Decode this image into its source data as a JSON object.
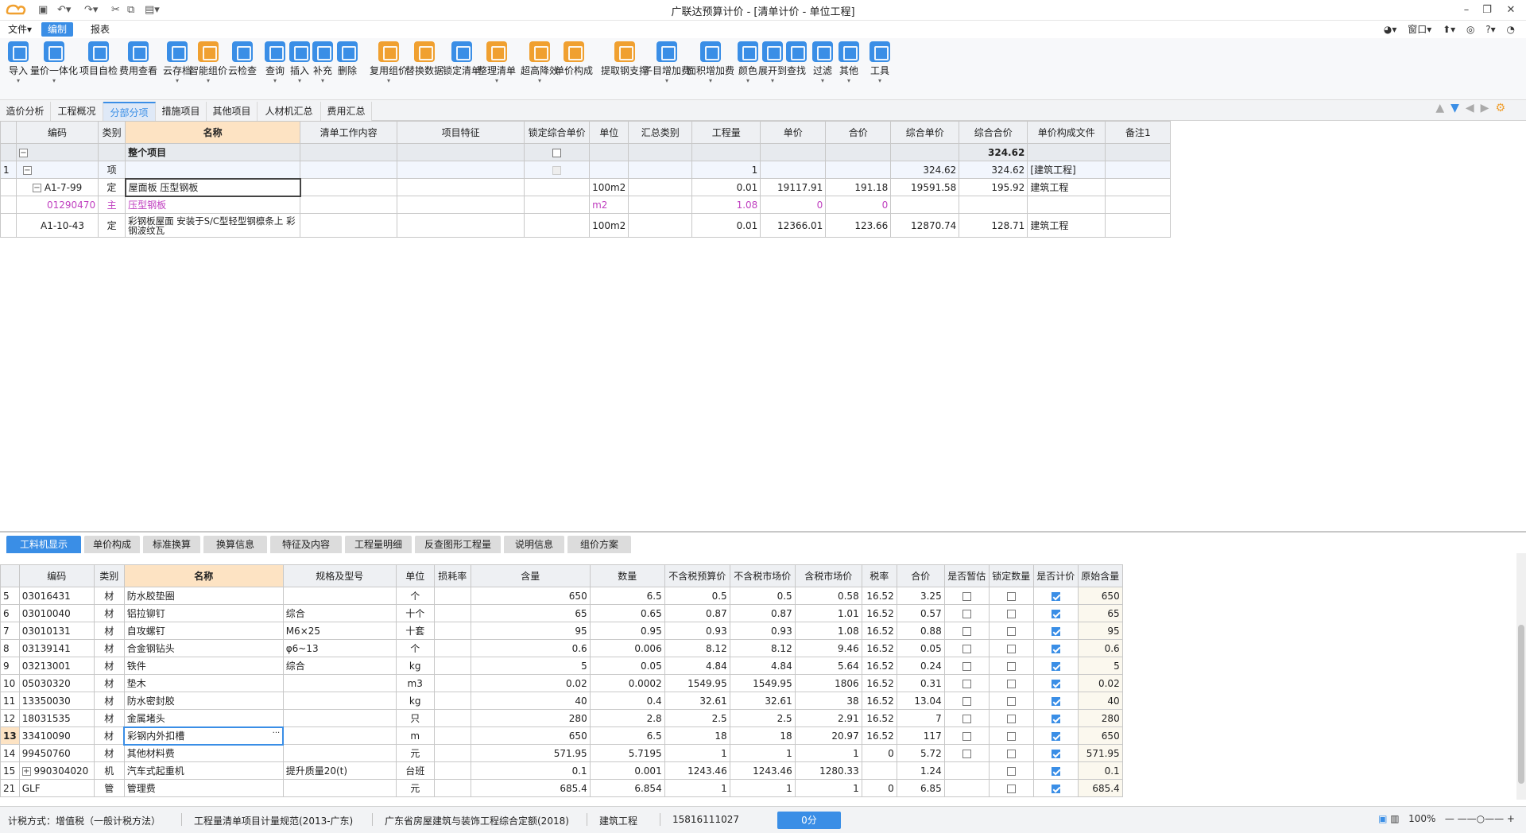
{
  "app": {
    "title": "广联达预算计价 - [清单计价 - 单位工程]"
  },
  "menu": {
    "file": "文件▾",
    "edit": "编制",
    "report": "报表"
  },
  "topright": {
    "window": "窗口▾",
    "help": "?▾"
  },
  "ribbon": [
    {
      "label": "导入",
      "icon": "import-icon",
      "color": "#3a8ee6",
      "dd": true
    },
    {
      "label": "量价一体化",
      "icon": "quantity-price-icon",
      "color": "#3a8ee6",
      "dd": true
    },
    {
      "label": "项目自检",
      "icon": "self-check-icon",
      "color": "#3a8ee6",
      "dd": false
    },
    {
      "label": "费用查看",
      "icon": "fee-view-icon",
      "color": "#3a8ee6",
      "dd": false
    },
    {
      "label": "云存档",
      "icon": "cloud-save-icon",
      "color": "#3a8ee6",
      "dd": true
    },
    {
      "label": "智能组价",
      "icon": "smart-price-icon",
      "color": "#f0a030",
      "dd": true
    },
    {
      "label": "云检查",
      "icon": "cloud-check-icon",
      "color": "#3a8ee6",
      "dd": false
    },
    {
      "label": "查询",
      "icon": "query-icon",
      "color": "#3a8ee6",
      "dd": true
    },
    {
      "label": "插入",
      "icon": "insert-icon",
      "color": "#3a8ee6",
      "dd": true
    },
    {
      "label": "补充",
      "icon": "supplement-icon",
      "color": "#3a8ee6",
      "dd": true
    },
    {
      "label": "删除",
      "icon": "delete-icon",
      "color": "#3a8ee6",
      "dd": false
    },
    {
      "label": "复用组价",
      "icon": "reuse-price-icon",
      "color": "#f0a030",
      "dd": true
    },
    {
      "label": "替换数据",
      "icon": "replace-data-icon",
      "color": "#f0a030",
      "dd": false
    },
    {
      "label": "锁定清单",
      "icon": "lock-list-icon",
      "color": "#3a8ee6",
      "dd": false
    },
    {
      "label": "整理清单",
      "icon": "organize-list-icon",
      "color": "#f0a030",
      "dd": true
    },
    {
      "label": "超高降效",
      "icon": "height-reduce-icon",
      "color": "#f0a030",
      "dd": true
    },
    {
      "label": "单价构成",
      "icon": "unit-price-icon",
      "color": "#f0a030",
      "dd": false
    },
    {
      "label": "提取钢支撑",
      "icon": "steel-support-icon",
      "color": "#f0a030",
      "dd": false
    },
    {
      "label": "子目增加费",
      "icon": "sub-item-fee-icon",
      "color": "#3a8ee6",
      "dd": true
    },
    {
      "label": "面积增加费",
      "icon": "area-fee-icon",
      "color": "#3a8ee6",
      "dd": true
    },
    {
      "label": "颜色",
      "icon": "color-icon",
      "color": "#3a8ee6",
      "dd": true
    },
    {
      "label": "展开到",
      "icon": "expand-icon",
      "color": "#3a8ee6",
      "dd": true
    },
    {
      "label": "查找",
      "icon": "find-icon",
      "color": "#3a8ee6",
      "dd": false
    },
    {
      "label": "过滤",
      "icon": "filter-icon",
      "color": "#3a8ee6",
      "dd": true
    },
    {
      "label": "其他",
      "icon": "other-icon",
      "color": "#3a8ee6",
      "dd": true
    },
    {
      "label": "工具",
      "icon": "tools-icon",
      "color": "#3a8ee6",
      "dd": true
    }
  ],
  "tabs": [
    "造价分析",
    "工程概况",
    "分部分项",
    "措施项目",
    "其他项目",
    "人材机汇总",
    "费用汇总"
  ],
  "active_tab": "分部分项",
  "top_table": {
    "headers": [
      "编码",
      "类别",
      "名称",
      "清单工作内容",
      "项目特征",
      "锁定综合单价",
      "单位",
      "汇总类别",
      "工程量",
      "单价",
      "合价",
      "综合单价",
      "综合合价",
      "单价构成文件",
      "备注1"
    ],
    "summary": {
      "name": "整个项目",
      "total": "324.62"
    },
    "rows": [
      {
        "idx": "1",
        "code": "",
        "type": "项",
        "name": "",
        "unit": "",
        "qty": "1",
        "price": "",
        "amount": "",
        "uprice": "324.62",
        "utotal": "324.62",
        "file": "[建筑工程]"
      },
      {
        "idx": "",
        "code": "A1-7-99",
        "type": "定",
        "name": "屋面板 压型钢板",
        "unit": "100m2",
        "qty": "0.01",
        "price": "19117.91",
        "amount": "191.18",
        "uprice": "19591.58",
        "utotal": "195.92",
        "file": "建筑工程"
      },
      {
        "idx": "",
        "code": "01290470",
        "type": "主",
        "name": "压型钢板",
        "unit": "m2",
        "qty": "1.08",
        "price": "0",
        "amount": "0",
        "uprice": "",
        "utotal": "",
        "file": ""
      },
      {
        "idx": "",
        "code": "A1-10-43",
        "type": "定",
        "name": "彩钢板屋面 安装于S/C型轻型钢檩条上 彩钢波纹瓦",
        "unit": "100m2",
        "qty": "0.01",
        "price": "12366.01",
        "amount": "123.66",
        "uprice": "12870.74",
        "utotal": "128.71",
        "file": "建筑工程"
      }
    ]
  },
  "bottom_tabs": [
    "工料机显示",
    "单价构成",
    "标准换算",
    "换算信息",
    "特征及内容",
    "工程量明细",
    "反查图形工程量",
    "说明信息",
    "组价方案"
  ],
  "bottom_table": {
    "headers": [
      "编码",
      "类别",
      "名称",
      "规格及型号",
      "单位",
      "损耗率",
      "含量",
      "数量",
      "不含税预算价",
      "不含税市场价",
      "含税市场价",
      "税率",
      "合价",
      "是否暂估",
      "锁定数量",
      "是否计价",
      "原始含量"
    ],
    "rows": [
      {
        "idx": "5",
        "code": "03016431",
        "type": "材",
        "name": "防水胶垫圈",
        "spec": "",
        "unit": "个",
        "content": "650",
        "qty": "6.5",
        "p1": "0.5",
        "p2": "0.5",
        "p3": "0.58",
        "tax": "16.52",
        "amount": "3.25",
        "orig": "650"
      },
      {
        "idx": "6",
        "code": "03010040",
        "type": "材",
        "name": "铝拉铆钉",
        "spec": "综合",
        "unit": "十个",
        "content": "65",
        "qty": "0.65",
        "p1": "0.87",
        "p2": "0.87",
        "p3": "1.01",
        "tax": "16.52",
        "amount": "0.57",
        "orig": "65"
      },
      {
        "idx": "7",
        "code": "03010131",
        "type": "材",
        "name": "自攻螺钉",
        "spec": "M6×25",
        "unit": "十套",
        "content": "95",
        "qty": "0.95",
        "p1": "0.93",
        "p2": "0.93",
        "p3": "1.08",
        "tax": "16.52",
        "amount": "0.88",
        "orig": "95"
      },
      {
        "idx": "8",
        "code": "03139141",
        "type": "材",
        "name": "合金钢钻头",
        "spec": "φ6~13",
        "unit": "个",
        "content": "0.6",
        "qty": "0.006",
        "p1": "8.12",
        "p2": "8.12",
        "p3": "9.46",
        "tax": "16.52",
        "amount": "0.05",
        "orig": "0.6"
      },
      {
        "idx": "9",
        "code": "03213001",
        "type": "材",
        "name": "铁件",
        "spec": "综合",
        "unit": "kg",
        "content": "5",
        "qty": "0.05",
        "p1": "4.84",
        "p2": "4.84",
        "p3": "5.64",
        "tax": "16.52",
        "amount": "0.24",
        "orig": "5"
      },
      {
        "idx": "10",
        "code": "05030320",
        "type": "材",
        "name": "垫木",
        "spec": "",
        "unit": "m3",
        "content": "0.02",
        "qty": "0.0002",
        "p1": "1549.95",
        "p2": "1549.95",
        "p3": "1806",
        "tax": "16.52",
        "amount": "0.31",
        "orig": "0.02"
      },
      {
        "idx": "11",
        "code": "13350030",
        "type": "材",
        "name": "防水密封胶",
        "spec": "",
        "unit": "kg",
        "content": "40",
        "qty": "0.4",
        "p1": "32.61",
        "p2": "32.61",
        "p3": "38",
        "tax": "16.52",
        "amount": "13.04",
        "orig": "40"
      },
      {
        "idx": "12",
        "code": "18031535",
        "type": "材",
        "name": "金属堵头",
        "spec": "",
        "unit": "只",
        "content": "280",
        "qty": "2.8",
        "p1": "2.5",
        "p2": "2.5",
        "p3": "2.91",
        "tax": "16.52",
        "amount": "7",
        "orig": "280"
      },
      {
        "idx": "13",
        "code": "33410090",
        "type": "材",
        "name": "彩钢内外扣槽",
        "spec": "",
        "unit": "m",
        "content": "650",
        "qty": "6.5",
        "p1": "18",
        "p2": "18",
        "p3": "20.97",
        "tax": "16.52",
        "amount": "117",
        "orig": "650"
      },
      {
        "idx": "14",
        "code": "99450760",
        "type": "材",
        "name": "其他材料费",
        "spec": "",
        "unit": "元",
        "content": "571.95",
        "qty": "5.7195",
        "p1": "1",
        "p2": "1",
        "p3": "1",
        "tax": "0",
        "amount": "5.72",
        "orig": "571.95"
      },
      {
        "idx": "15",
        "code": "990304020",
        "type": "机",
        "name": "汽车式起重机",
        "spec": "提升质量20(t)",
        "unit": "台班",
        "content": "0.1",
        "qty": "0.001",
        "p1": "1243.46",
        "p2": "1243.46",
        "p3": "1280.33",
        "tax": "",
        "amount": "1.24",
        "orig": "0.1"
      },
      {
        "idx": "21",
        "code": "GLF",
        "type": "管",
        "name": "管理费",
        "spec": "",
        "unit": "元",
        "content": "685.4",
        "qty": "6.854",
        "p1": "1",
        "p2": "1",
        "p3": "1",
        "tax": "0",
        "amount": "6.85",
        "orig": "685.4"
      }
    ]
  },
  "status": {
    "tax": "计税方式：增值税（一般计税方法）",
    "rule": "工程量清单项目计量规范(2013-广东)",
    "quota": "广东省房屋建筑与装饰工程综合定额(2018)",
    "type": "建筑工程",
    "phone": "15816111027",
    "score": "0分",
    "zoom": "100%"
  }
}
